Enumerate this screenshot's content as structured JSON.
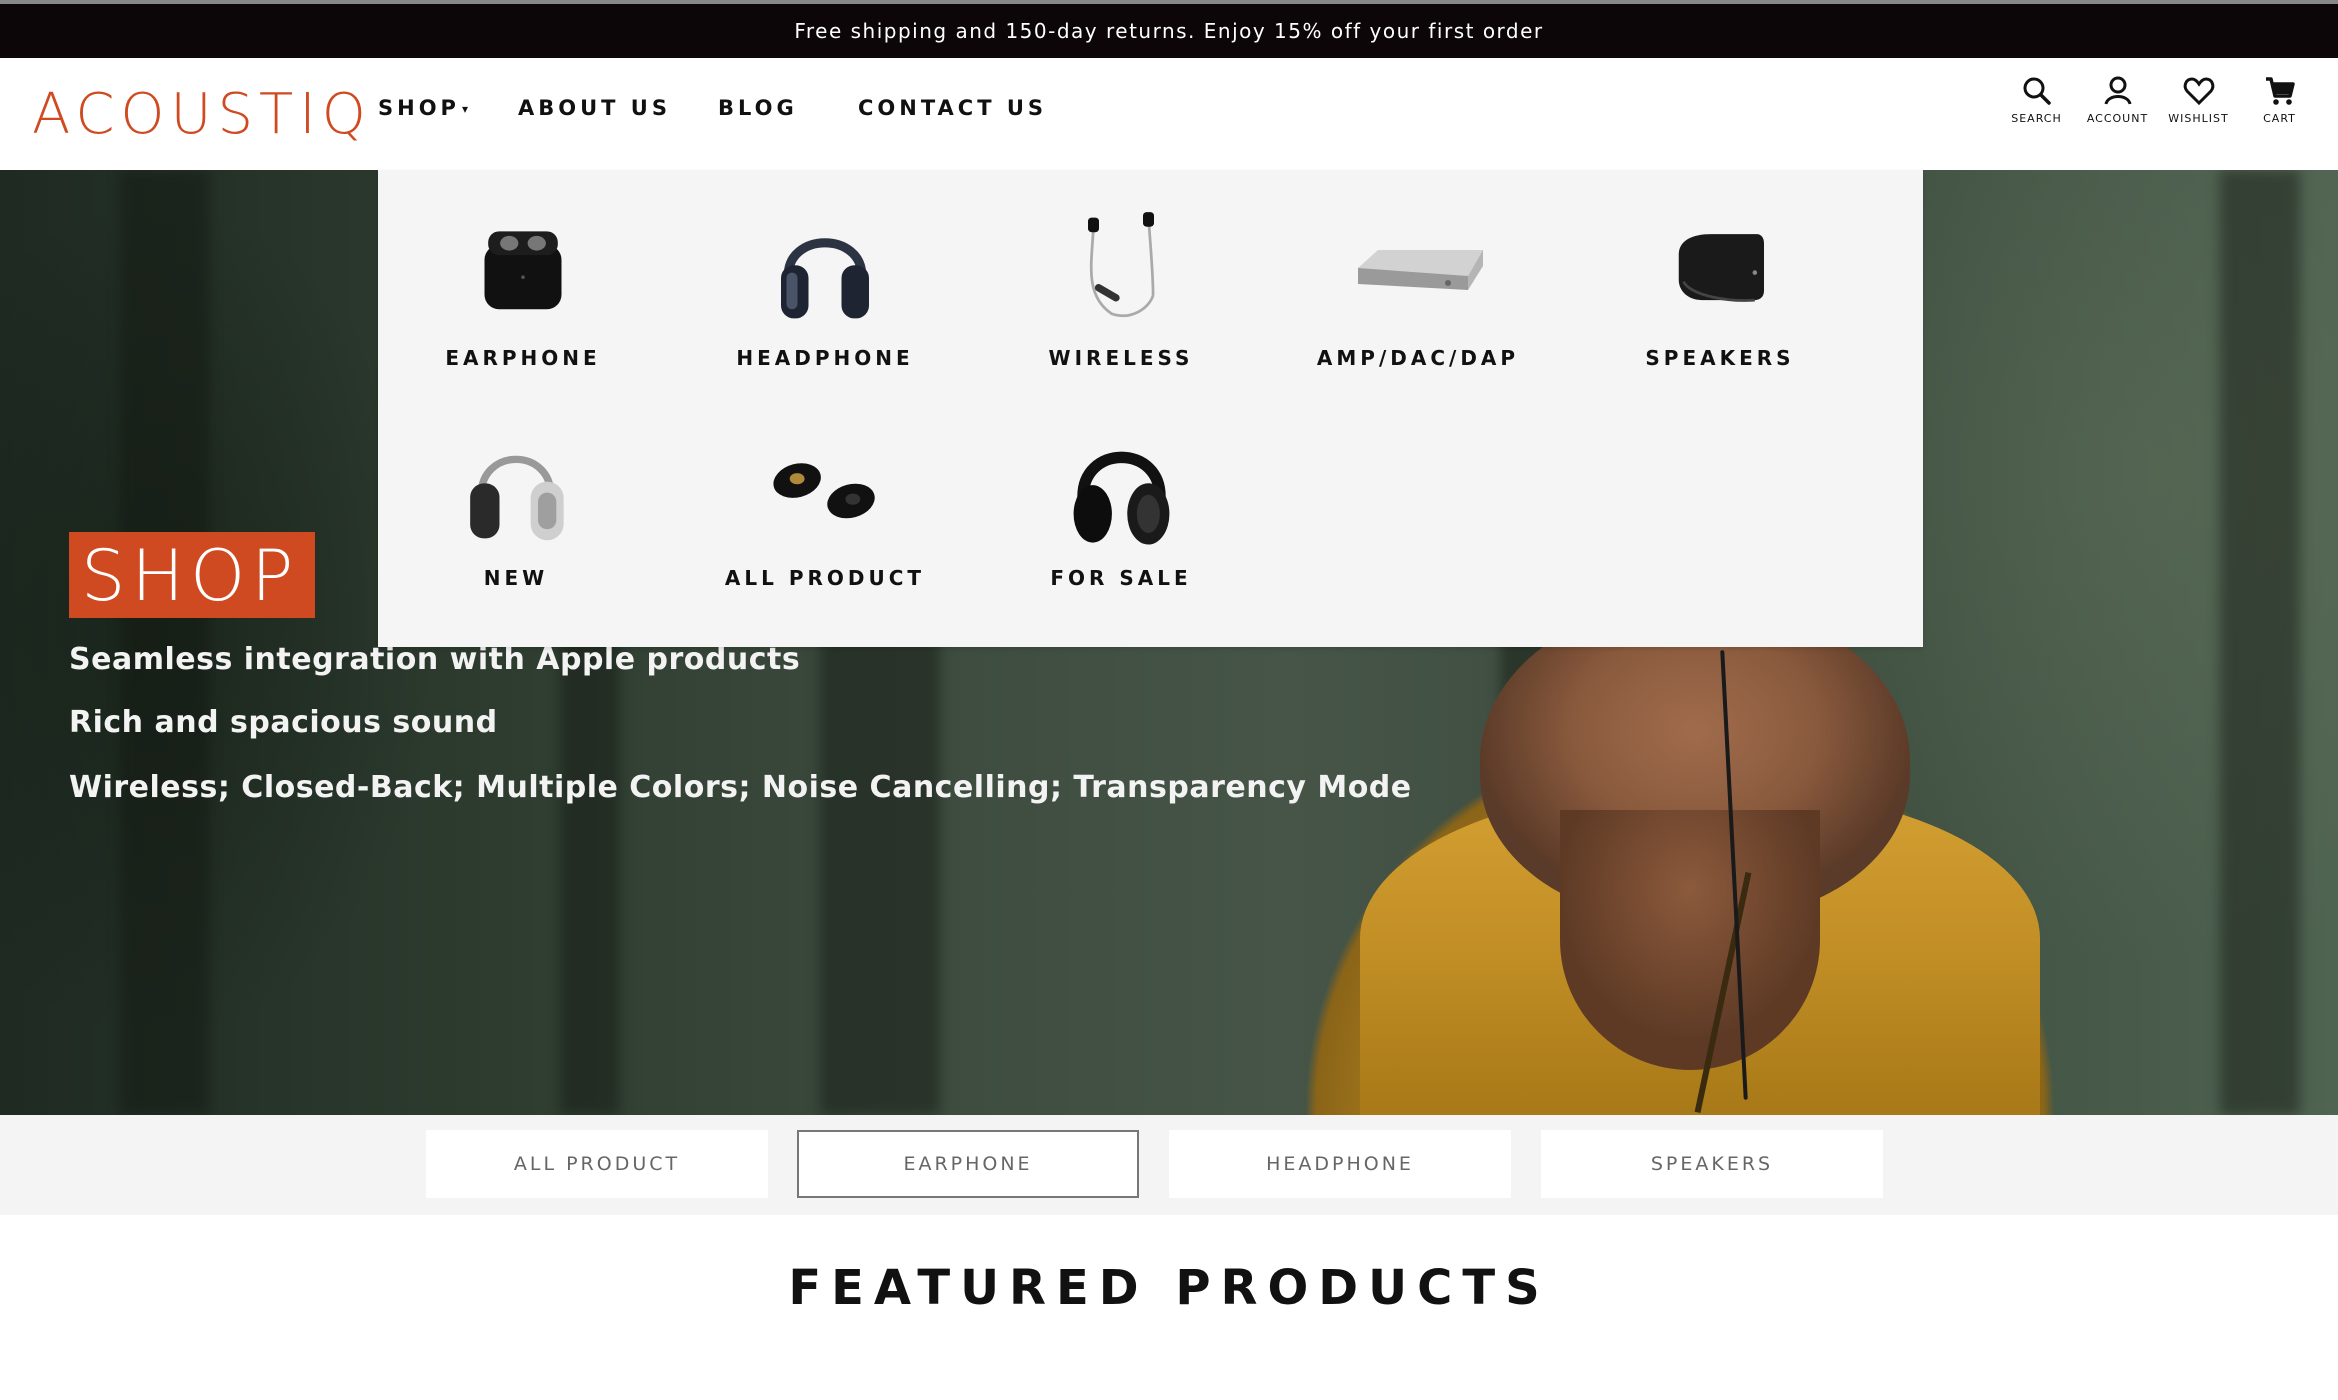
{
  "promo": {
    "text": "Free shipping and 150-day returns. Enjoy 15% off your first order"
  },
  "brand": {
    "logo": "ACOUSTIQ",
    "accent_color": "#d04a21"
  },
  "nav": {
    "items": [
      {
        "label": "SHOP"
      },
      {
        "label": "ABOUT US"
      },
      {
        "label": "BLOG"
      },
      {
        "label": "CONTACT US"
      }
    ]
  },
  "utilities": {
    "search": {
      "label": "SEARCH",
      "icon": "search-icon"
    },
    "account": {
      "label": "ACCOUNT",
      "icon": "user-icon"
    },
    "wishlist": {
      "label": "WISHLIST",
      "icon": "heart-icon"
    },
    "cart": {
      "label": "CART",
      "icon": "cart-icon"
    }
  },
  "mega_menu": {
    "items": [
      {
        "label": "EARPHONE",
        "icon": "earbuds-case-image"
      },
      {
        "label": "HEADPHONE",
        "icon": "headphone-image"
      },
      {
        "label": "WIRELESS",
        "icon": "neckband-earphone-image"
      },
      {
        "label": "AMP/DAC/DAP",
        "icon": "amplifier-image"
      },
      {
        "label": "SPEAKERS",
        "icon": "speaker-image"
      },
      {
        "label": "NEW",
        "icon": "white-headphone-image"
      },
      {
        "label": "ALL PRODUCT",
        "icon": "true-wireless-earbuds-image"
      },
      {
        "label": "FOR SALE",
        "icon": "black-headphone-image"
      }
    ]
  },
  "hero": {
    "badge": "SHOP",
    "line1": "Seamless integration with Apple products",
    "line2": "Rich and spacious sound",
    "line3": "Wireless; Closed-Back; Multiple Colors; Noise Cancelling; Transparency Mode"
  },
  "filters": {
    "items": [
      {
        "label": "ALL PRODUCT",
        "active": false
      },
      {
        "label": "EARPHONE",
        "active": true
      },
      {
        "label": "HEADPHONE",
        "active": false
      },
      {
        "label": "SPEAKERS",
        "active": false
      }
    ]
  },
  "featured": {
    "title": "FEATURED PRODUCTS"
  }
}
